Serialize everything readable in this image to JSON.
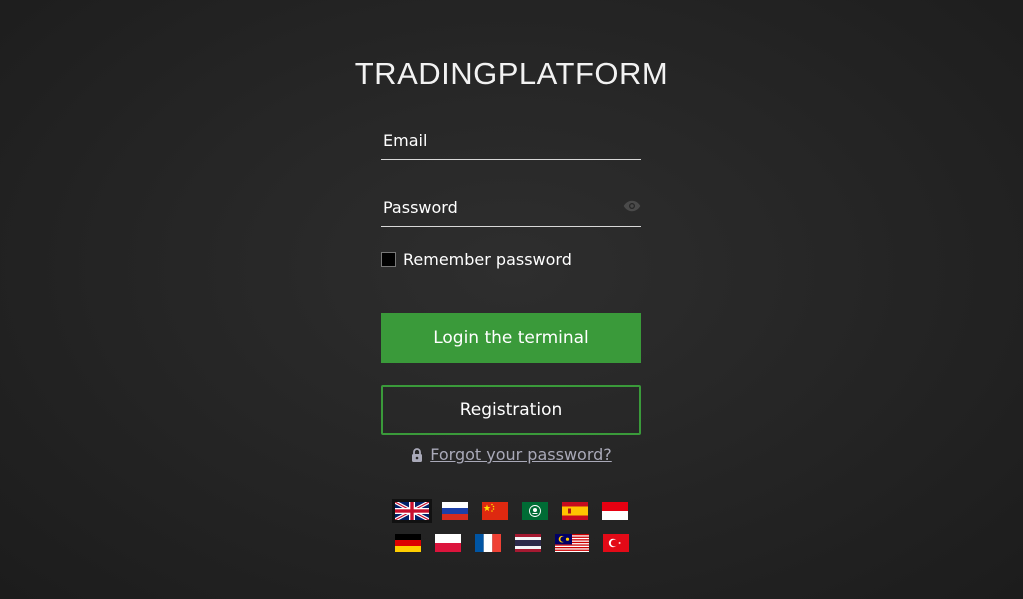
{
  "title": "TRADINGPLATFORM",
  "form": {
    "email_placeholder": "Email",
    "password_placeholder": "Password",
    "remember_label": "Remember password",
    "login_label": "Login the terminal",
    "register_label": "Registration",
    "forgot_label": "Forgot your password?"
  },
  "icons": {
    "eye": "eye-icon",
    "lock": "lock-icon"
  },
  "colors": {
    "accent": "#3a9a3a",
    "background": "#262626",
    "link": "#a9a9b8"
  },
  "languages": {
    "row1": [
      "english",
      "russian",
      "chinese",
      "arabic",
      "spanish",
      "indonesian"
    ],
    "row2": [
      "german",
      "polish",
      "french",
      "thai",
      "malay",
      "turkish"
    ],
    "selected": "english"
  }
}
